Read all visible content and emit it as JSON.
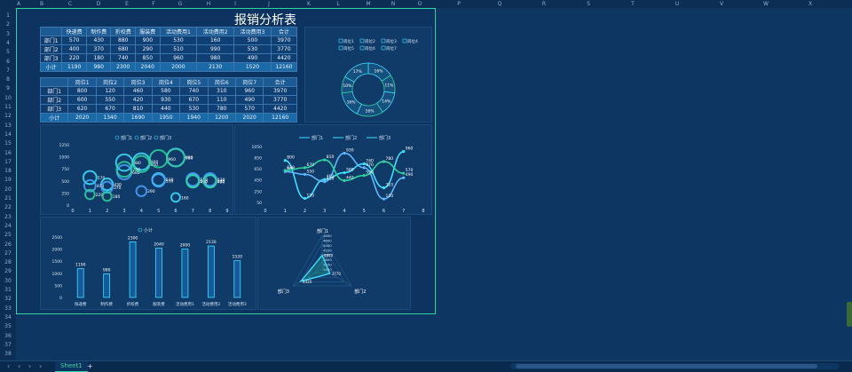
{
  "columns": [
    "A",
    "B",
    "C",
    "D",
    "E",
    "F",
    "G",
    "H",
    "I",
    "J",
    "K",
    "L",
    "M",
    "N",
    "O",
    "P",
    "Q",
    "R",
    "S",
    "T",
    "U",
    "V",
    "W",
    "X"
  ],
  "rows": [
    "1",
    "2",
    "3",
    "4",
    "5",
    "6",
    "7",
    "8",
    "9",
    "10",
    "11",
    "12",
    "13",
    "14",
    "15",
    "16",
    "17",
    "18",
    "19",
    "20",
    "21",
    "22",
    "23",
    "24",
    "25",
    "26",
    "27",
    "28",
    "29",
    "30",
    "31",
    "32",
    "33",
    "34",
    "35",
    "36",
    "37",
    "38"
  ],
  "title": "报销分析表",
  "table1": {
    "header": [
      "",
      "快递费",
      "制作费",
      "折校费",
      "服装费",
      "活动费用1",
      "活动费用2",
      "活动费用3",
      "合计"
    ],
    "rows": [
      [
        "部门1",
        "570",
        "430",
        "880",
        "900",
        "530",
        "160",
        "500",
        "3970"
      ],
      [
        "部门2",
        "400",
        "370",
        "680",
        "290",
        "510",
        "990",
        "530",
        "3770"
      ],
      [
        "部门3",
        "220",
        "180",
        "740",
        "850",
        "960",
        "980",
        "490",
        "4420"
      ],
      [
        "小计",
        "1190",
        "980",
        "2300",
        "2040",
        "2000",
        "2130",
        "1520",
        "12160"
      ]
    ]
  },
  "table2": {
    "header": [
      "",
      "岗位1",
      "岗位2",
      "岗位3",
      "岗位4",
      "岗位5",
      "岗位6",
      "岗位7",
      "合计"
    ],
    "rows": [
      [
        "部门1",
        "800",
        "120",
        "460",
        "580",
        "740",
        "310",
        "960",
        "3970"
      ],
      [
        "部门2",
        "600",
        "550",
        "420",
        "930",
        "670",
        "110",
        "490",
        "3770"
      ],
      [
        "部门3",
        "620",
        "670",
        "810",
        "440",
        "530",
        "780",
        "570",
        "4420"
      ],
      [
        "小计",
        "2020",
        "1340",
        "1690",
        "1950",
        "1940",
        "1200",
        "2020",
        "12160"
      ]
    ]
  },
  "sheet_tab": "Sheet1",
  "add_sheet": "+",
  "colors": {
    "accent": "#2dd4a0",
    "bg": "#0d3461",
    "cyan": "#3fe0ff"
  },
  "chart_data": [
    {
      "type": "pie",
      "variant": "doughnut",
      "legend": [
        "岗位1",
        "岗位2",
        "岗位3",
        "岗位4",
        "岗位5",
        "岗位6",
        "岗位7"
      ],
      "legend_placement": "top",
      "values": [
        16,
        11,
        14,
        16,
        16,
        10,
        17
      ],
      "labels": [
        "16%",
        "11%",
        "14%",
        "16%",
        "16%",
        "10%",
        "17%"
      ]
    },
    {
      "type": "scatter",
      "variant": "bubble",
      "legend": [
        "部门1",
        "部门2",
        "部门3"
      ],
      "legend_placement": "top",
      "xlim": [
        0,
        9
      ],
      "ylim": [
        0,
        1250
      ],
      "xticks": [
        "0",
        "1",
        "2",
        "3",
        "4",
        "5",
        "6",
        "7",
        "8",
        "9"
      ],
      "yticks": [
        "0",
        "100",
        "200",
        "300",
        "400",
        "500",
        "600",
        "700",
        "800",
        "900",
        "1000",
        "1100",
        "1250"
      ],
      "series": [
        {
          "name": "部门1",
          "x": [
            1,
            2,
            3,
            4,
            5,
            6,
            7,
            8
          ],
          "y": [
            570,
            430,
            880,
            900,
            530,
            160,
            500,
            500
          ],
          "labels": [
            "570",
            "430",
            "880",
            "900",
            "530",
            "160",
            "500",
            "500"
          ]
        },
        {
          "name": "部门2",
          "x": [
            1,
            2,
            3,
            4,
            5,
            6,
            7,
            8
          ],
          "y": [
            400,
            370,
            680,
            290,
            510,
            990,
            530,
            530
          ],
          "labels": [
            "400",
            "370",
            "680",
            "290",
            "510",
            "990",
            "530",
            "530"
          ]
        },
        {
          "name": "部门3",
          "x": [
            1,
            2,
            3,
            4,
            5,
            6,
            7,
            8
          ],
          "y": [
            220,
            180,
            740,
            850,
            960,
            980,
            490,
            490
          ],
          "labels": [
            "220",
            "180",
            "740",
            "850",
            "960",
            "980",
            "490",
            "490"
          ]
        }
      ]
    },
    {
      "type": "line",
      "legend": [
        "部门1",
        "部门2",
        "部门3"
      ],
      "legend_placement": "top",
      "xlim": [
        0,
        8
      ],
      "ylim": [
        0,
        1050
      ],
      "xticks": [
        "0",
        "1",
        "2",
        "3",
        "4",
        "5",
        "6",
        "7",
        "8"
      ],
      "yticks": [
        "0",
        "50",
        "250",
        "450",
        "650",
        "850",
        "1050"
      ],
      "series": [
        {
          "name": "部门1",
          "x": [
            1,
            2,
            3,
            4,
            5,
            6,
            7
          ],
          "y": [
            800,
            120,
            460,
            580,
            740,
            310,
            960
          ]
        },
        {
          "name": "部门2",
          "x": [
            1,
            2,
            3,
            4,
            5,
            6,
            7
          ],
          "y": [
            600,
            550,
            420,
            930,
            670,
            110,
            490
          ]
        },
        {
          "name": "部门3",
          "x": [
            1,
            2,
            3,
            4,
            5,
            6,
            7
          ],
          "y": [
            620,
            670,
            810,
            440,
            530,
            780,
            570
          ]
        }
      ],
      "point_labels": [
        "800",
        "120",
        "460",
        "580",
        "740",
        "310",
        "960",
        "600",
        "550",
        "420",
        "930",
        "670",
        "110",
        "490",
        "620",
        "670",
        "810",
        "440",
        "530",
        "780",
        "570"
      ]
    },
    {
      "type": "bar",
      "legend": [
        "小计"
      ],
      "legend_placement": "top",
      "categories": [
        "快递费",
        "制作费",
        "折校费",
        "服装费",
        "活动费用1",
        "活动费用2",
        "活动费用3"
      ],
      "values": [
        1190,
        980,
        2300,
        2040,
        2000,
        2130,
        1520
      ],
      "ylim": [
        0,
        2500
      ],
      "yticks": [
        "0",
        "500",
        "1000",
        "1500",
        "2000",
        "2500"
      ]
    },
    {
      "type": "radar",
      "axes": [
        "部门1",
        "部门2",
        "部门3"
      ],
      "values": [
        3970,
        3770,
        4420
      ],
      "rlim": [
        3400,
        4800
      ],
      "rticks": [
        "3400",
        "3600",
        "3800",
        "4000",
        "4200",
        "4400",
        "4600",
        "4800"
      ],
      "labels": [
        "3970",
        "3770",
        "4420"
      ]
    }
  ]
}
